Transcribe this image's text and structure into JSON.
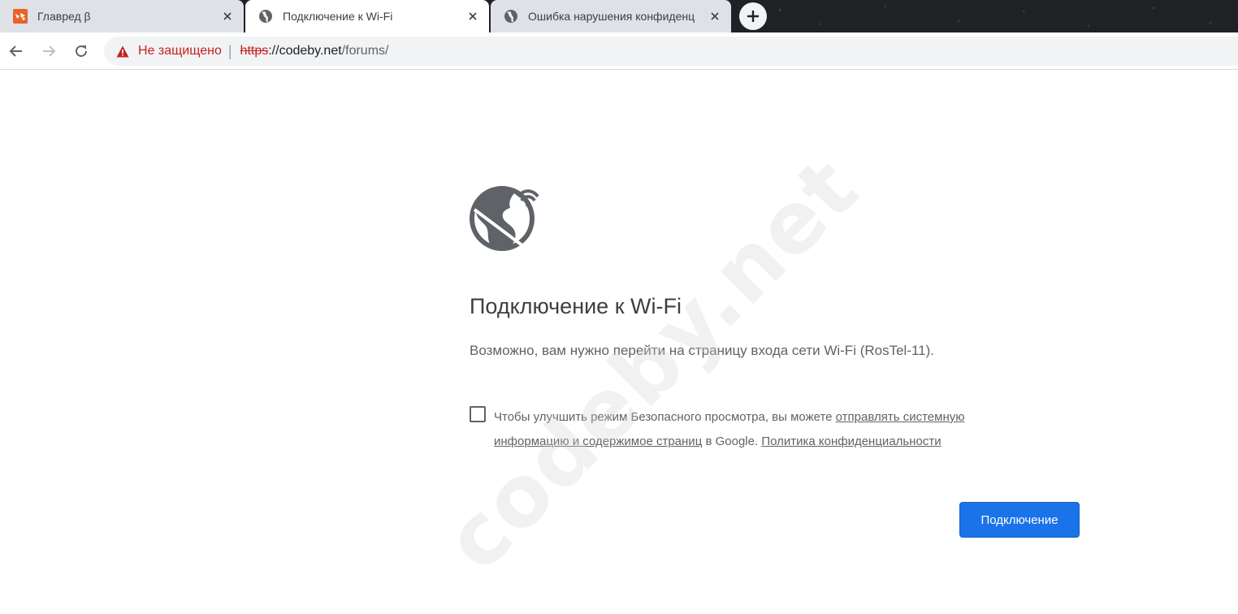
{
  "tabs": [
    {
      "title": "Главред β",
      "favicon": "glavred-favicon",
      "active": false
    },
    {
      "title": "Подключение к Wi-Fi",
      "favicon": "globe-icon",
      "active": true
    },
    {
      "title": "Ошибка нарушения конфиденц",
      "favicon": "globe-icon",
      "active": false
    }
  ],
  "toolbar": {
    "security_label": "Не защищено",
    "separator": "|",
    "url_scheme": "https",
    "url_host": "://codeby.net",
    "url_path": "/forums/"
  },
  "page": {
    "heading": "Подключение к Wi-Fi",
    "message": "Возможно, вам нужно перейти на страницу входа сети Wi-Fi (RosTel-11).",
    "optin_prefix": "Чтобы улучшить режим Безопасного просмотра, вы можете ",
    "optin_link": "отправлять системную информацию и содержимое страниц",
    "optin_middle": " в Google. ",
    "privacy_link": "Политика конфиденциальности",
    "connect_button": "Подключение",
    "watermark": "codeby.net"
  },
  "colors": {
    "accent": "#1a73e8",
    "insecure": "#c5221f",
    "tabstrip": "#202124"
  }
}
